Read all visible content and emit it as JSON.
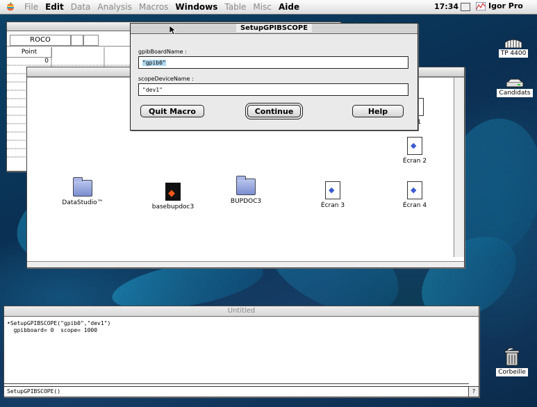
{
  "menubar": {
    "items": [
      "File",
      "Edit",
      "Data",
      "Analysis",
      "Macros",
      "Windows",
      "Table",
      "Misc",
      "Aide"
    ],
    "active": [
      "Edit",
      "Windows",
      "Aide"
    ],
    "clock": "17:34",
    "app_name": "Igor Pro"
  },
  "table_window": {
    "header_cells": [
      "ROCO",
      "",
      ""
    ],
    "column_title": "Point",
    "first_value": "0"
  },
  "dialog": {
    "title": "SetupGPIBSCOPE",
    "field1_label": "gpibBoardName :",
    "field1_value": "\"gpib0\"",
    "field2_label": "scopeDeviceName :",
    "field2_value": "\"dev1\"",
    "quit_label": "Quit Macro",
    "continue_label": "Continue",
    "help_label": "Help"
  },
  "finder": {
    "icons": [
      {
        "label": "DataStudio™",
        "kind": "folder"
      },
      {
        "label": "basebupdoc3",
        "kind": "app"
      },
      {
        "label": "BUPDOC3",
        "kind": "folder"
      },
      {
        "label": "Écran 3",
        "kind": "doc"
      },
      {
        "label": "Écran 4",
        "kind": "doc"
      }
    ],
    "right_icons": [
      {
        "label": "n 1"
      },
      {
        "label": "Écran 2"
      }
    ]
  },
  "command_window": {
    "title": "Untitled",
    "history_line1": "•SetupGPIBSCOPE(\"gpib0\",\"dev1\")",
    "history_line2": "  gpibboard= 0  scope= 1000",
    "command_line": "SetupGPIBSCOPE()"
  },
  "desktop": {
    "icons": [
      "TP 4400",
      "Candidats",
      "Corbeille"
    ]
  }
}
